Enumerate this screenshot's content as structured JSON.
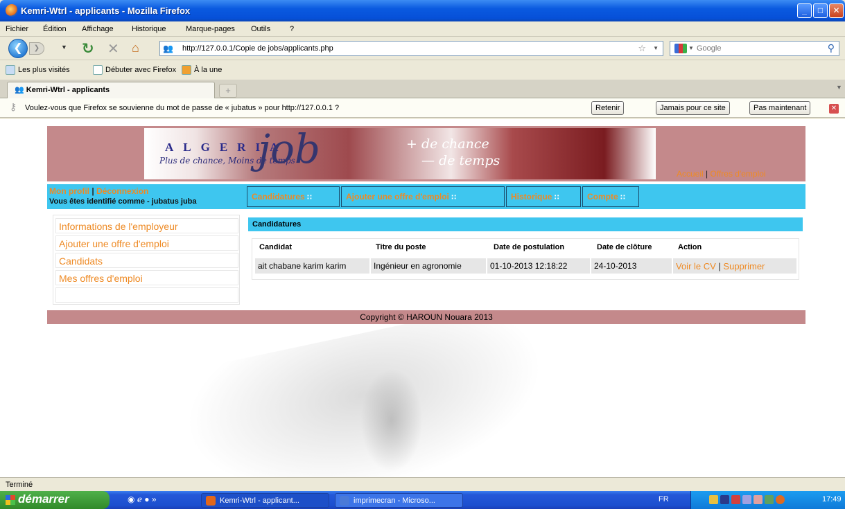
{
  "window": {
    "title": "Kemri-Wtrl - applicants - Mozilla Firefox"
  },
  "menu": [
    "Fichier",
    "Édition",
    "Affichage",
    "Historique",
    "Marque-pages",
    "Outils",
    "?"
  ],
  "url": "http://127.0.0.1/Copie de jobs/applicants.php",
  "search_placeholder": "Google",
  "bookmarks": [
    "Les plus visités",
    "Débuter avec Firefox",
    "À la une"
  ],
  "tab": {
    "title": "Kemri-Wtrl - applicants",
    "new": "+"
  },
  "password_bar": {
    "message": "Voulez-vous que Firefox se souvienne du mot de passe de « jubatus » pour http://127.0.0.1 ?",
    "remember": "Retenir",
    "never": "Jamais pour ce site",
    "not_now": "Pas maintenant"
  },
  "banner": {
    "letters": "ALGERIA",
    "tagline": "Plus de chance, Moins de temps",
    "logo_word": "job",
    "plus_chance": "+ de chance",
    "minus_temps": "— de temps",
    "link_home": "Accueil",
    "link_offers": "Offres d'emploi"
  },
  "user": {
    "profile": "Mon profil",
    "logout": "Déconnexion",
    "identified": "Vous êtes identifié comme - jubatus juba"
  },
  "nav_tabs": [
    "Candidatures",
    "Ajouter une offre d'emploi",
    "Historique",
    "Compte"
  ],
  "left_menu": [
    "Informations de l'employeur",
    "Ajouter une offre d'emploi",
    "Candidats",
    "Mes offres d'emploi"
  ],
  "panel": {
    "title": "Candidatures",
    "columns": [
      "Candidat",
      "Titre du poste",
      "Date de postulation",
      "Date de clôture",
      "Action"
    ],
    "rows": [
      {
        "candidate": "ait chabane karim karim",
        "position": "Ingénieur en agronomie",
        "applied": "01-10-2013 12:18:22",
        "closing": "24-10-2013",
        "view": "Voir le CV",
        "delete": "Supprimer"
      }
    ]
  },
  "footer": "Copyright © HAROUN Nouara 2013",
  "status": "Terminé",
  "taskbar": {
    "start": "démarrer",
    "tasks": [
      "Kemri-Wtrl - applicant...",
      "imprimecran - Microso..."
    ],
    "lang": "FR",
    "time": "17:49"
  },
  "colors": {
    "accent_blue": "#3ec6ef",
    "link_orange": "#ee8a24",
    "banner_rose": "#c4898b"
  }
}
